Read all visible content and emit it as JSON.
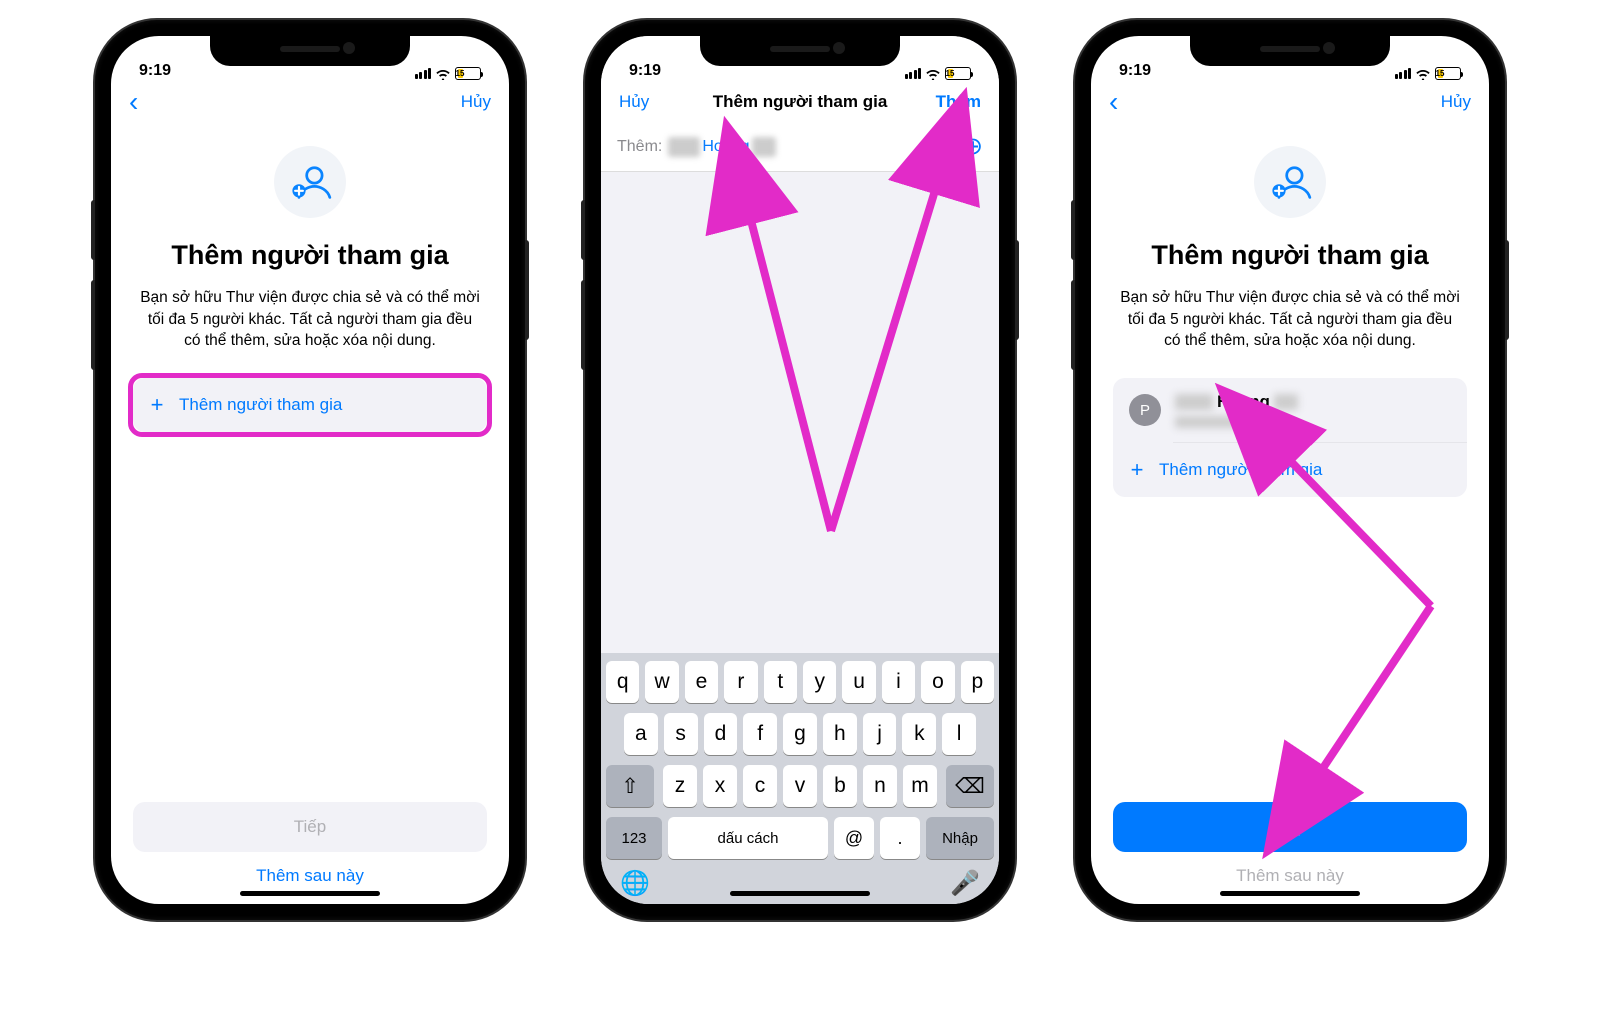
{
  "status": {
    "time": "9:19",
    "battery": "15"
  },
  "screen1": {
    "nav": {
      "cancel": "Hủy"
    },
    "title": "Thêm người tham gia",
    "desc": "Bạn sở hữu Thư viện được chia sẻ và có thể mời tối đa 5 người khác. Tất cả người tham gia đều có thể thêm, sửa hoặc xóa nội dung.",
    "add_row": "Thêm người tham gia",
    "next": "Tiếp",
    "later": "Thêm sau này"
  },
  "screen2": {
    "nav": {
      "cancel": "Hủy",
      "title": "Thêm người tham gia",
      "add": "Thêm"
    },
    "search": {
      "label": "Thêm:",
      "name": "Hoang"
    },
    "keyboard": {
      "r1": [
        "q",
        "w",
        "e",
        "r",
        "t",
        "y",
        "u",
        "i",
        "o",
        "p"
      ],
      "r2": [
        "a",
        "s",
        "d",
        "f",
        "g",
        "h",
        "j",
        "k",
        "l"
      ],
      "r3": [
        "z",
        "x",
        "c",
        "v",
        "b",
        "n",
        "m"
      ],
      "numkey": "123",
      "space": "dấu cách",
      "at": "@",
      "dot": ".",
      "return": "Nhập"
    }
  },
  "screen3": {
    "nav": {
      "cancel": "Hủy"
    },
    "title": "Thêm người tham gia",
    "desc": "Bạn sở hữu Thư viện được chia sẻ và có thể mời tối đa 5 người khác. Tất cả người tham gia đều có thể thêm, sửa hoặc xóa nội dung.",
    "participant": {
      "initial": "P",
      "name": "Hoang"
    },
    "add_row": "Thêm người tham gia",
    "next": "Tiếp",
    "later": "Thêm sau này"
  }
}
